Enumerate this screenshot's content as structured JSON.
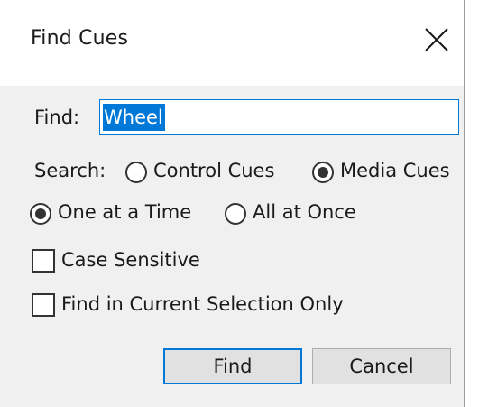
{
  "window": {
    "title": "Find Cues",
    "close_icon": "close-icon"
  },
  "find": {
    "label": "Find:",
    "value": "Wheel",
    "value_selected": true
  },
  "search": {
    "label": "Search:",
    "options": [
      {
        "label": "Control Cues",
        "selected": false
      },
      {
        "label": "Media Cues",
        "selected": true
      }
    ]
  },
  "mode": {
    "options": [
      {
        "label": "One at a Time",
        "selected": true
      },
      {
        "label": "All at Once",
        "selected": false
      }
    ]
  },
  "checkboxes": [
    {
      "label": "Case Sensitive",
      "checked": false
    },
    {
      "label": "Find in Current Selection Only",
      "checked": false
    }
  ],
  "buttons": {
    "find": "Find",
    "cancel": "Cancel"
  },
  "colors": {
    "accent": "#0078d7",
    "dialog_background": "#f0f0f0",
    "title_background": "#ffffff"
  }
}
